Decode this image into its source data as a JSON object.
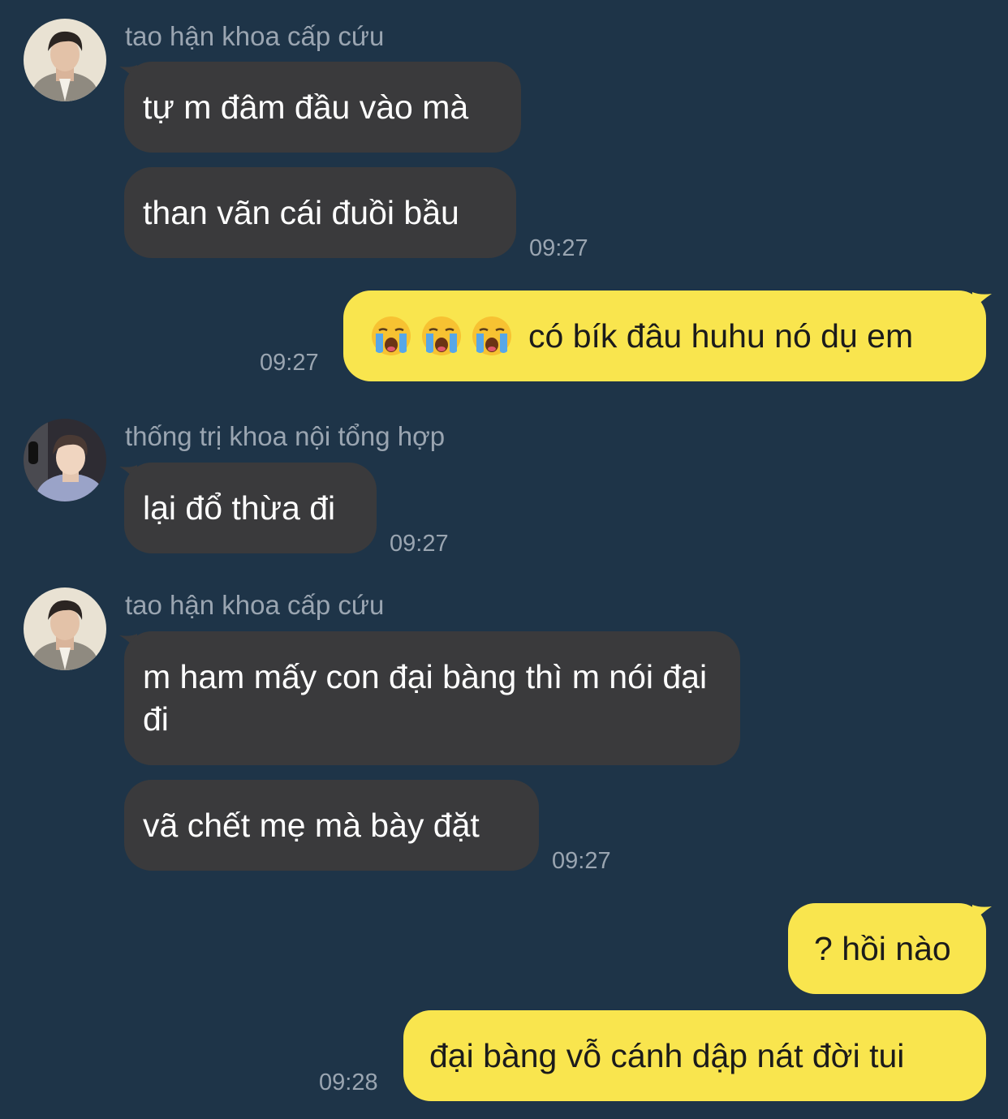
{
  "messages": [
    {
      "sender": "tao hận khoa cấp cứu",
      "bubbles": [
        "tự m đâm đầu vào mà",
        "than vãn cái đuồi bầu"
      ],
      "time": "09:27"
    },
    {
      "outgoing": true,
      "emoji": [
        "crying-face",
        "crying-face",
        "crying-face"
      ],
      "text": "có bík đâu huhu nó dụ em",
      "time": "09:27"
    },
    {
      "sender": "thống trị khoa nội tổng hợp",
      "bubbles": [
        "lại đổ thừa đi"
      ],
      "time": "09:27"
    },
    {
      "sender": "tao hận khoa cấp cứu",
      "bubbles": [
        "m ham mấy con đại bàng thì m nói đại đi",
        "vã chết mẹ mà bày đặt"
      ],
      "time": "09:27"
    },
    {
      "outgoing": true,
      "bubbles": [
        "? hồi nào",
        "đại bàng vỗ cánh dập nát đời tui"
      ],
      "time": "09:28"
    }
  ],
  "colors": {
    "background": "#1e3448",
    "incoming_bubble": "#3a3a3c",
    "outgoing_bubble": "#f9e54e",
    "meta_text": "#9aa5b1"
  }
}
